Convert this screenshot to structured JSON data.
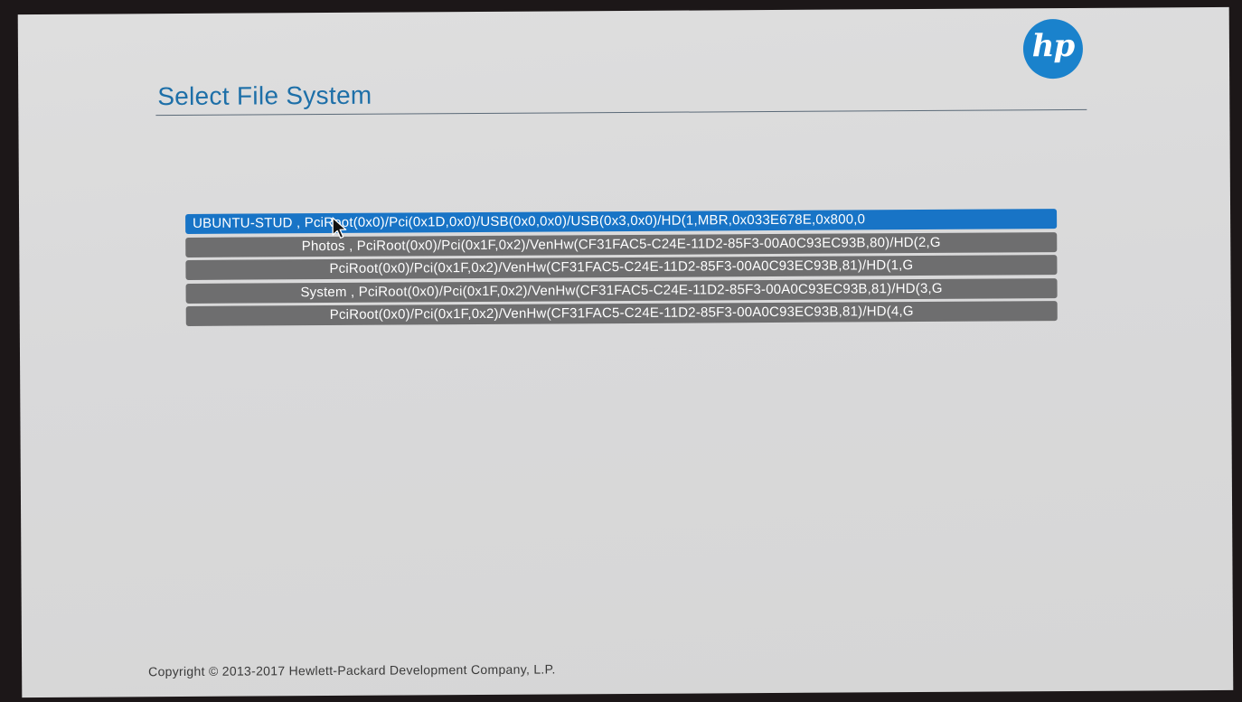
{
  "header": {
    "title": "Select File System",
    "logo_text": "hp",
    "brand_color": "#1a82cc",
    "title_color": "#1d6fa8"
  },
  "file_systems": {
    "selected_index": 0,
    "selected_color": "#1874c6",
    "item_color": "#6e6e6f",
    "items": [
      {
        "label": "UBUNTU-STUD , PciRoot(0x0)/Pci(0x1D,0x0)/USB(0x0,0x0)/USB(0x3,0x0)/HD(1,MBR,0x033E678E,0x800,0"
      },
      {
        "label": "Photos , PciRoot(0x0)/Pci(0x1F,0x2)/VenHw(CF31FAC5-C24E-11D2-85F3-00A0C93EC93B,80)/HD(2,G"
      },
      {
        "label": "PciRoot(0x0)/Pci(0x1F,0x2)/VenHw(CF31FAC5-C24E-11D2-85F3-00A0C93EC93B,81)/HD(1,G"
      },
      {
        "label": "System , PciRoot(0x0)/Pci(0x1F,0x2)/VenHw(CF31FAC5-C24E-11D2-85F3-00A0C93EC93B,81)/HD(3,G"
      },
      {
        "label": "PciRoot(0x0)/Pci(0x1F,0x2)/VenHw(CF31FAC5-C24E-11D2-85F3-00A0C93EC93B,81)/HD(4,G"
      }
    ]
  },
  "footer": {
    "copyright": "Copyright © 2013-2017 Hewlett-Packard Development Company, L.P."
  },
  "icons": {
    "logo": "hp-logo-icon",
    "cursor": "mouse-pointer-icon"
  }
}
